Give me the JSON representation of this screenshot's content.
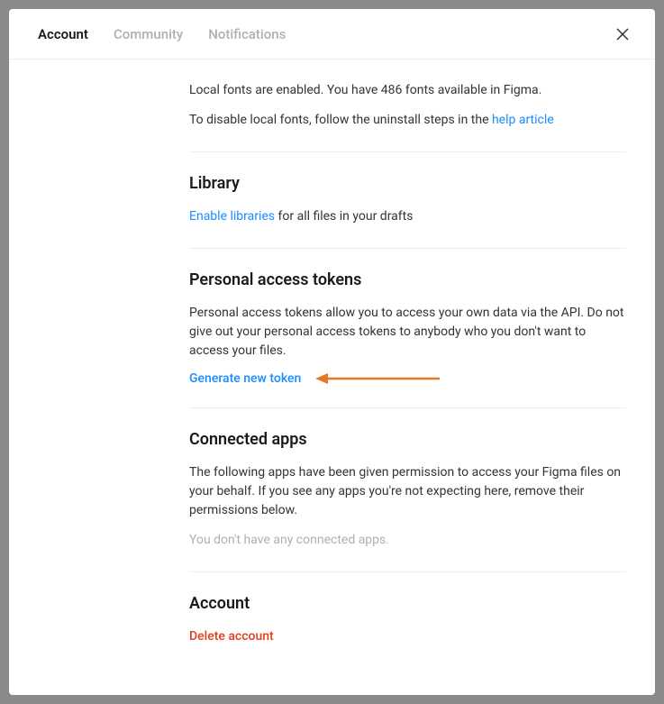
{
  "tabs": {
    "account": "Account",
    "community": "Community",
    "notifications": "Notifications"
  },
  "fonts": {
    "enabled_text": "Local fonts are enabled. You have 486 fonts available in Figma.",
    "disable_prefix": "To disable local fonts, follow the uninstall steps in the ",
    "help_link": "help article"
  },
  "library": {
    "heading": "Library",
    "enable_link": "Enable libraries",
    "enable_suffix": " for all files in your drafts"
  },
  "tokens": {
    "heading": "Personal access tokens",
    "description": "Personal access tokens allow you to access your own data via the API. Do not give out your personal access tokens to anybody who you don't want to access your files.",
    "generate_link": "Generate new token"
  },
  "connected": {
    "heading": "Connected apps",
    "description": "The following apps have been given permission to access your Figma files on your behalf. If you see any apps you're not expecting here, remove their permissions below.",
    "empty": "You don't have any connected apps."
  },
  "account": {
    "heading": "Account",
    "delete_link": "Delete account"
  }
}
